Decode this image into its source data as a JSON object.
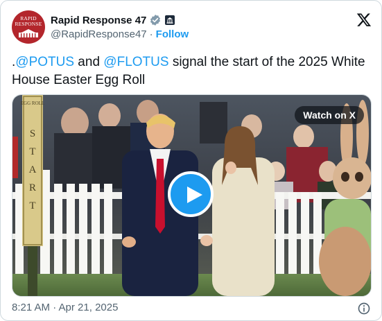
{
  "account": {
    "display_name": "Rapid Response 47",
    "handle": "@RapidResponse47",
    "separator": "·",
    "follow_label": "Follow",
    "avatar_text": "RAPID RESPONSE",
    "verified_color": "#829aab",
    "avatar_color": "#b3262c"
  },
  "tweet": {
    "prefix": ".",
    "mention1": "@POTUS",
    "text1": " and ",
    "mention2": "@FLOTUS",
    "text2": " signal the start of the 2025 White House Easter Egg Roll"
  },
  "media": {
    "watch_label": "Watch on X",
    "sign_top": "EGG ROLL",
    "sign_main": "START",
    "play_icon": "play-icon"
  },
  "footer": {
    "timestamp": "8:21 AM · Apr 21, 2025",
    "info_icon": "info-icon"
  },
  "colors": {
    "accent": "#1d9bf0",
    "text": "#0f1419",
    "secondary": "#536471"
  }
}
